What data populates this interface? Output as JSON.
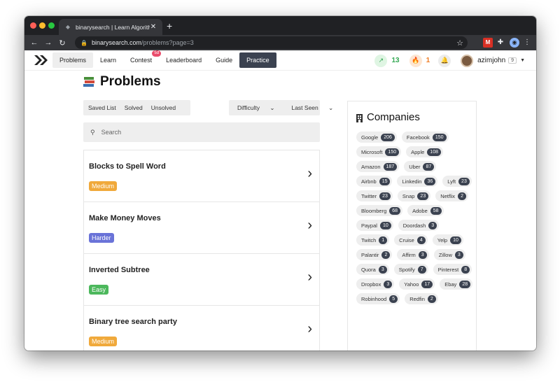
{
  "browser": {
    "tab_title": "binarysearch | Learn Algorithms",
    "tab_close": "✕",
    "new_tab": "+",
    "url_host": "binarysearch.com",
    "url_path": "/problems?page=3"
  },
  "appnav": {
    "links": [
      {
        "label": "Problems"
      },
      {
        "label": "Learn"
      },
      {
        "label": "Contest",
        "badge": "5d"
      },
      {
        "label": "Leaderboard"
      },
      {
        "label": "Guide"
      },
      {
        "label": "Practice"
      }
    ],
    "streak": "13",
    "flame": "1",
    "username": "azimjohn",
    "level": "9"
  },
  "page": {
    "title": "Problems",
    "filters": [
      "Saved List",
      "Solved",
      "Unsolved"
    ],
    "difficulty_label": "Difficulty",
    "last_seen_label": "Last Seen",
    "search_placeholder": "Search"
  },
  "problems": [
    {
      "name": "Blocks to Spell Word",
      "difficulty": "Medium",
      "color": "#f0a93b"
    },
    {
      "name": "Make Money Moves",
      "difficulty": "Harder",
      "color": "#6a73d8"
    },
    {
      "name": "Inverted Subtree",
      "difficulty": "Easy",
      "color": "#4cb85c"
    },
    {
      "name": "Binary tree search party",
      "difficulty": "Medium",
      "color": "#f0a93b"
    }
  ],
  "companies": {
    "title": "Companies",
    "list": [
      {
        "name": "Google",
        "count": "206"
      },
      {
        "name": "Facebook",
        "count": "150"
      },
      {
        "name": "Microsoft",
        "count": "150"
      },
      {
        "name": "Apple",
        "count": "108"
      },
      {
        "name": "Amazon",
        "count": "187"
      },
      {
        "name": "Uber",
        "count": "87"
      },
      {
        "name": "Airbnb",
        "count": "15"
      },
      {
        "name": "Linkedin",
        "count": "36"
      },
      {
        "name": "Lyft",
        "count": "23"
      },
      {
        "name": "Twitter",
        "count": "23"
      },
      {
        "name": "Snap",
        "count": "23"
      },
      {
        "name": "Netflix",
        "count": "2"
      },
      {
        "name": "Bloomberg",
        "count": "68"
      },
      {
        "name": "Adobe",
        "count": "58"
      },
      {
        "name": "Paypal",
        "count": "10"
      },
      {
        "name": "Doordash",
        "count": "3"
      },
      {
        "name": "Twitch",
        "count": "1"
      },
      {
        "name": "Cruise",
        "count": "4"
      },
      {
        "name": "Yelp",
        "count": "10"
      },
      {
        "name": "Palantir",
        "count": "2"
      },
      {
        "name": "Affirm",
        "count": "3"
      },
      {
        "name": "Zillow",
        "count": "3"
      },
      {
        "name": "Quora",
        "count": "3"
      },
      {
        "name": "Spotify",
        "count": "7"
      },
      {
        "name": "Pinterest",
        "count": "8"
      },
      {
        "name": "Dropbox",
        "count": "3"
      },
      {
        "name": "Yahoo",
        "count": "17"
      },
      {
        "name": "Ebay",
        "count": "28"
      },
      {
        "name": "Robinhood",
        "count": "5"
      },
      {
        "name": "Redfin",
        "count": "2"
      }
    ]
  }
}
